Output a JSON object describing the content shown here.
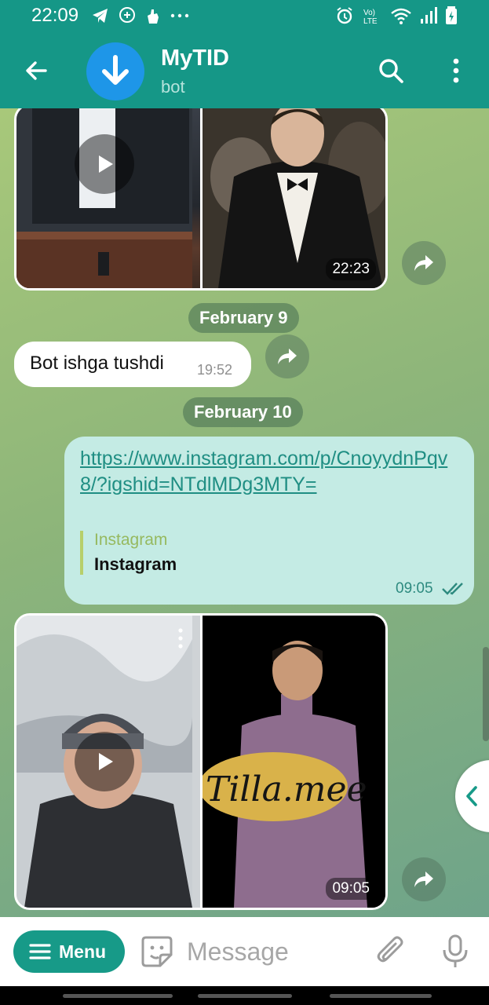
{
  "status_bar": {
    "time": "22:09",
    "left_icons": [
      "telegram-icon",
      "chat-plus-icon",
      "hand-icon",
      "more-dots-icon"
    ],
    "right_icons": [
      "alarm-icon",
      "volte-icon",
      "wifi-icon",
      "signal-icon",
      "battery-icon"
    ]
  },
  "header": {
    "title": "MyTID",
    "subtitle": "bot",
    "avatar_icon": "download-arrow-icon",
    "back_icon": "back-arrow-icon",
    "search_icon": "search-icon",
    "more_icon": "more-vertical-icon"
  },
  "messages": {
    "album1": {
      "time": "22:23"
    },
    "date1": "February 9",
    "incoming": {
      "text": "Bot ishga tushdi",
      "time": "19:52"
    },
    "date2": "February 10",
    "outgoing": {
      "link": "https://www.instagram.com/p/CnoyydnPqv8/?igshid=NTdlMDg3MTY=",
      "preview_site": "Instagram",
      "preview_title": "Instagram",
      "time": "09:05"
    },
    "album2": {
      "time": "09:05",
      "caption_on_photo": "Tilla.mee"
    }
  },
  "input_bar": {
    "menu_label": "Menu",
    "placeholder": "Message"
  },
  "colors": {
    "header": "#159787",
    "outgoing_bubble": "#c4ebe4",
    "link": "#1f8e83",
    "menu_button": "#179a88"
  }
}
